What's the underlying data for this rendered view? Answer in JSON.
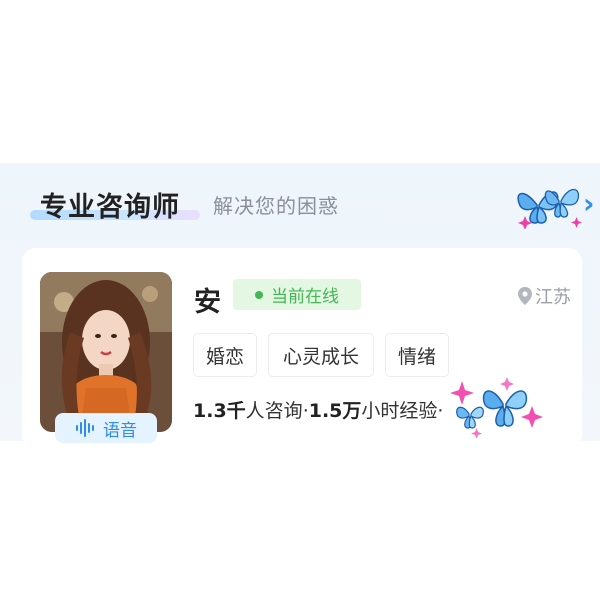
{
  "section": {
    "title": "专业咨询师",
    "subtitle": "解决您的困惑",
    "more_icon": "chevron-right-icon"
  },
  "counselor": {
    "name": "安",
    "status": "当前在线",
    "location": "江苏",
    "voice_label": "语音",
    "tags": [
      "婚恋",
      "心灵成长",
      "情绪"
    ],
    "consult_count": "1.3千",
    "consult_unit": "人咨询",
    "hours_count": "1.5万",
    "hours_unit": "小时经验",
    "separator": "·"
  },
  "colors": {
    "accent": "#2f8df0",
    "online": "#43b655",
    "online_bg": "#e3f7e3",
    "butterfly": "#4fa3e8",
    "sparkle": "#f03ca8"
  }
}
